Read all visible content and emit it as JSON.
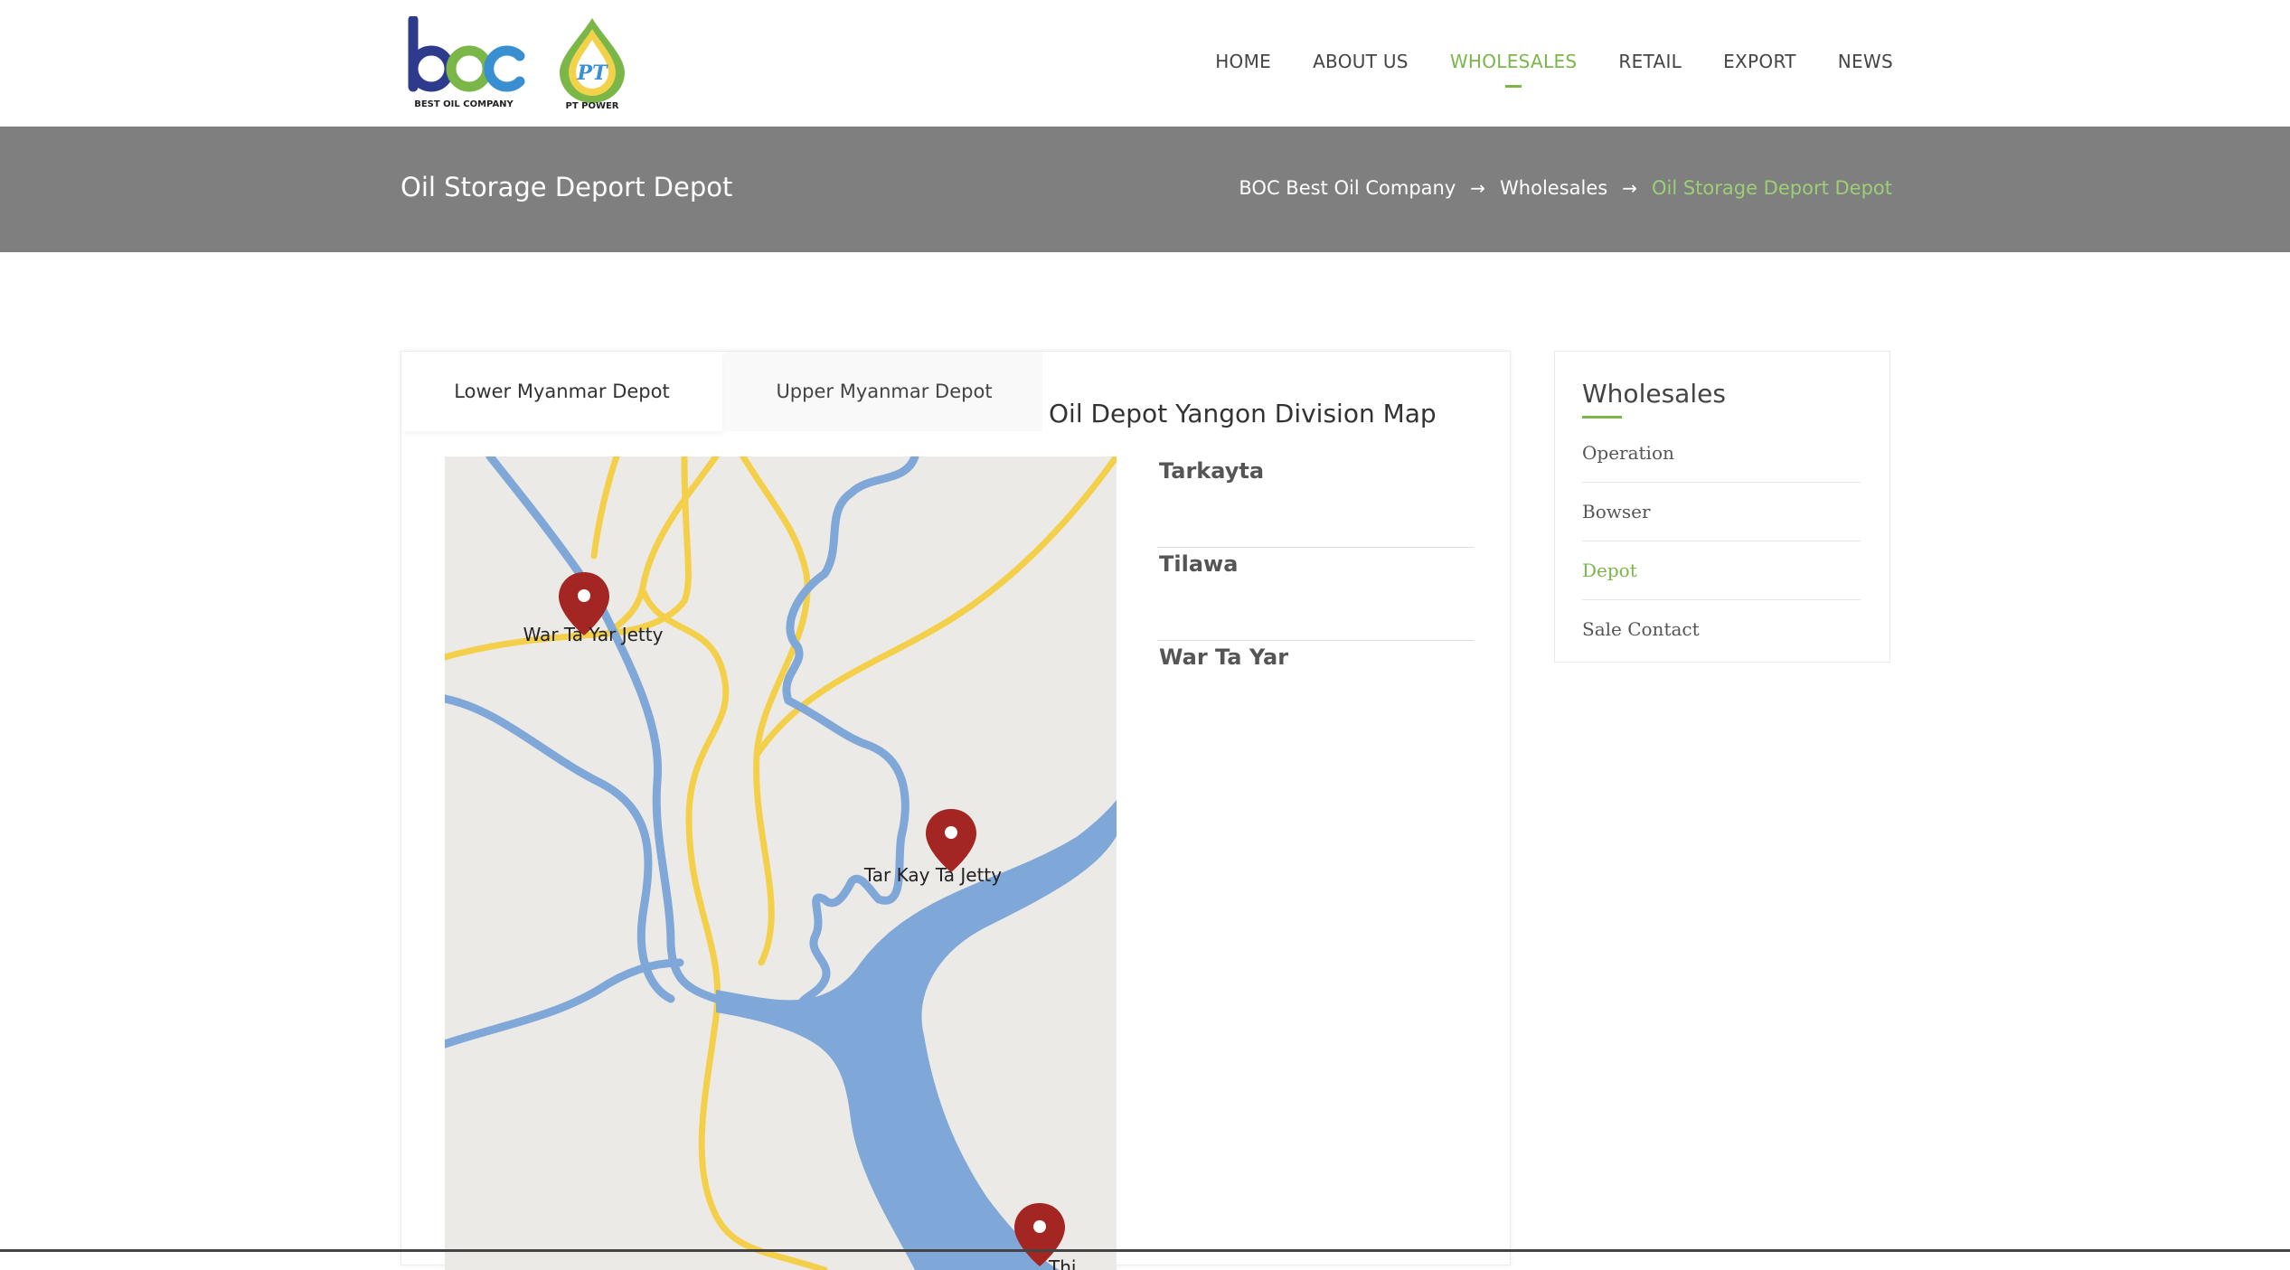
{
  "header": {
    "logo_boc": {
      "mark": "boc",
      "caption": "BEST OIL COMPANY"
    },
    "logo_pt": {
      "mark": "PT",
      "caption": "PT POWER"
    },
    "nav": [
      {
        "label": "HOME",
        "active": false
      },
      {
        "label": "ABOUT US",
        "active": false
      },
      {
        "label": "WHOLESALES",
        "active": true
      },
      {
        "label": "RETAIL",
        "active": false
      },
      {
        "label": "EXPORT",
        "active": false
      },
      {
        "label": "NEWS",
        "active": false
      }
    ]
  },
  "banner": {
    "title": "Oil Storage Deport Depot",
    "breadcrumb": [
      "BOC Best Oil Company",
      "Wholesales",
      "Oil Storage Deport Depot"
    ],
    "separator": "→"
  },
  "content": {
    "tabs": [
      {
        "label": "Lower Myanmar Depot",
        "active": true
      },
      {
        "label": "Upper Myanmar Depot",
        "active": false
      }
    ],
    "map_heading": "Oil Depot Yangon Division Map",
    "map_markers": [
      {
        "label": "War Ta Yar Jetty"
      },
      {
        "label": "Tar Kay Ta Jetty"
      },
      {
        "label": "Thi"
      }
    ],
    "locations": [
      "Tarkayta",
      "Tilawa",
      "War Ta Yar"
    ]
  },
  "sidebar": {
    "title": "Wholesales",
    "items": [
      {
        "label": "Operation",
        "active": false
      },
      {
        "label": "Bowser",
        "active": false
      },
      {
        "label": "Depot",
        "active": true
      },
      {
        "label": "Sale Contact",
        "active": false
      }
    ]
  },
  "colors": {
    "accent": "#7ab648",
    "banner": "#7f7f7f",
    "river": "#7fa7d8",
    "road": "#f4d04a",
    "marker": "#a32622",
    "map_bg": "#eceae6"
  }
}
